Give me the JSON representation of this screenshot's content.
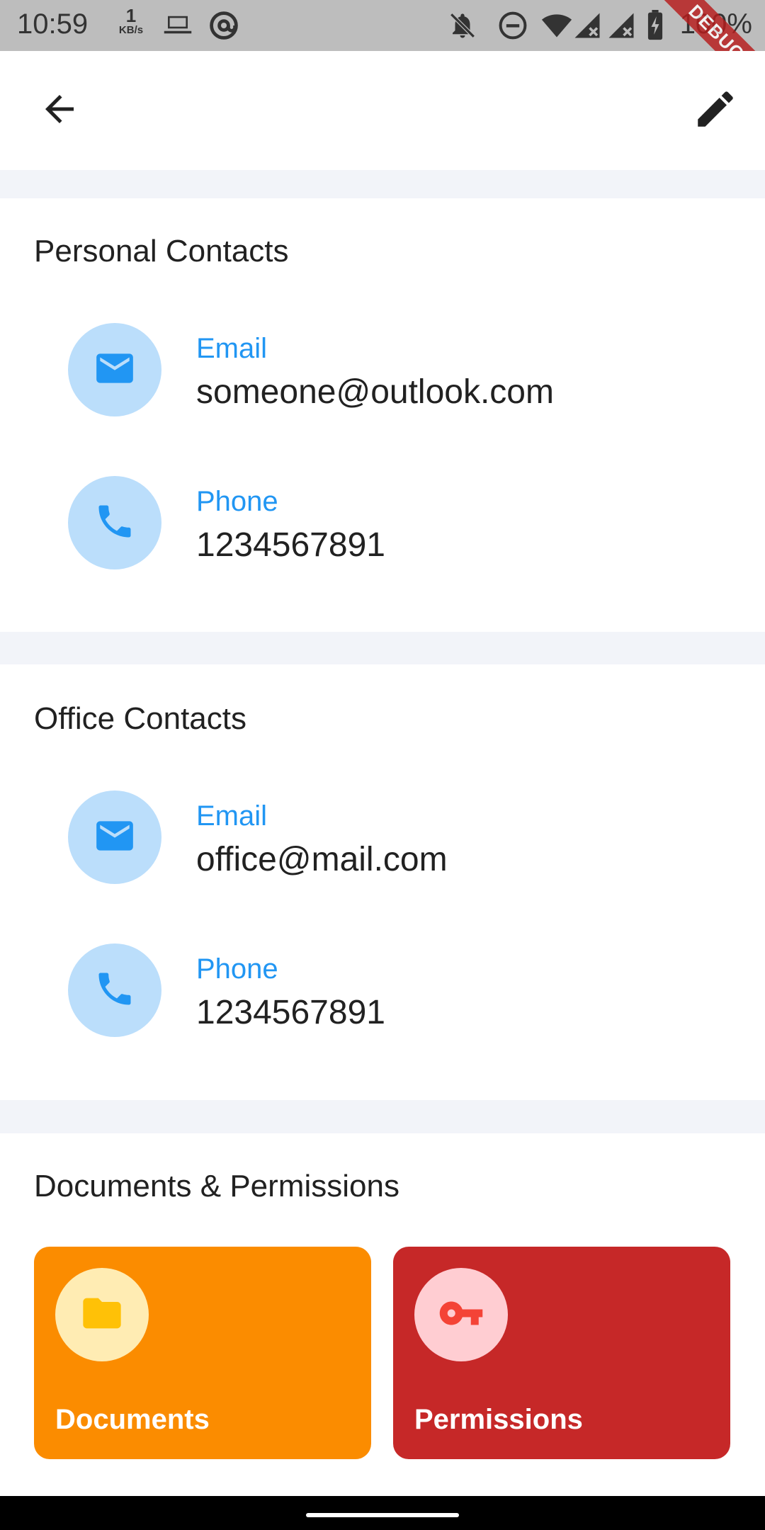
{
  "status_bar": {
    "time": "10:59",
    "net_speed_value": "1",
    "net_speed_unit": "KB/s",
    "battery": "100%",
    "icons": [
      "laptop-icon",
      "at-sign-icon",
      "notifications-off-icon",
      "do-not-disturb-icon",
      "wifi-icon",
      "signal-icon",
      "signal-icon",
      "battery-charging-icon"
    ]
  },
  "debug_banner": "DEBUG",
  "app_bar": {
    "back_icon": "arrow-back-icon",
    "edit_icon": "edit-pencil-icon"
  },
  "personal_contacts": {
    "title": "Personal Contacts",
    "items": [
      {
        "icon": "email-icon",
        "label": "Email",
        "value": "someone@outlook.com"
      },
      {
        "icon": "phone-icon",
        "label": "Phone",
        "value": "1234567891"
      }
    ]
  },
  "office_contacts": {
    "title": "Office Contacts",
    "items": [
      {
        "icon": "email-icon",
        "label": "Email",
        "value": "office@mail.com"
      },
      {
        "icon": "phone-icon",
        "label": "Phone",
        "value": "1234567891"
      }
    ]
  },
  "documents_permissions": {
    "title": "Documents & Permissions",
    "cards": [
      {
        "icon": "folder-icon",
        "label": "Documents",
        "color": "#fb8c00"
      },
      {
        "icon": "key-icon",
        "label": "Permissions",
        "color": "#c62828"
      }
    ]
  },
  "colors": {
    "accent": "#2196f3",
    "avatar_bg": "#bbdefb",
    "page_bg": "#f2f4f9"
  }
}
